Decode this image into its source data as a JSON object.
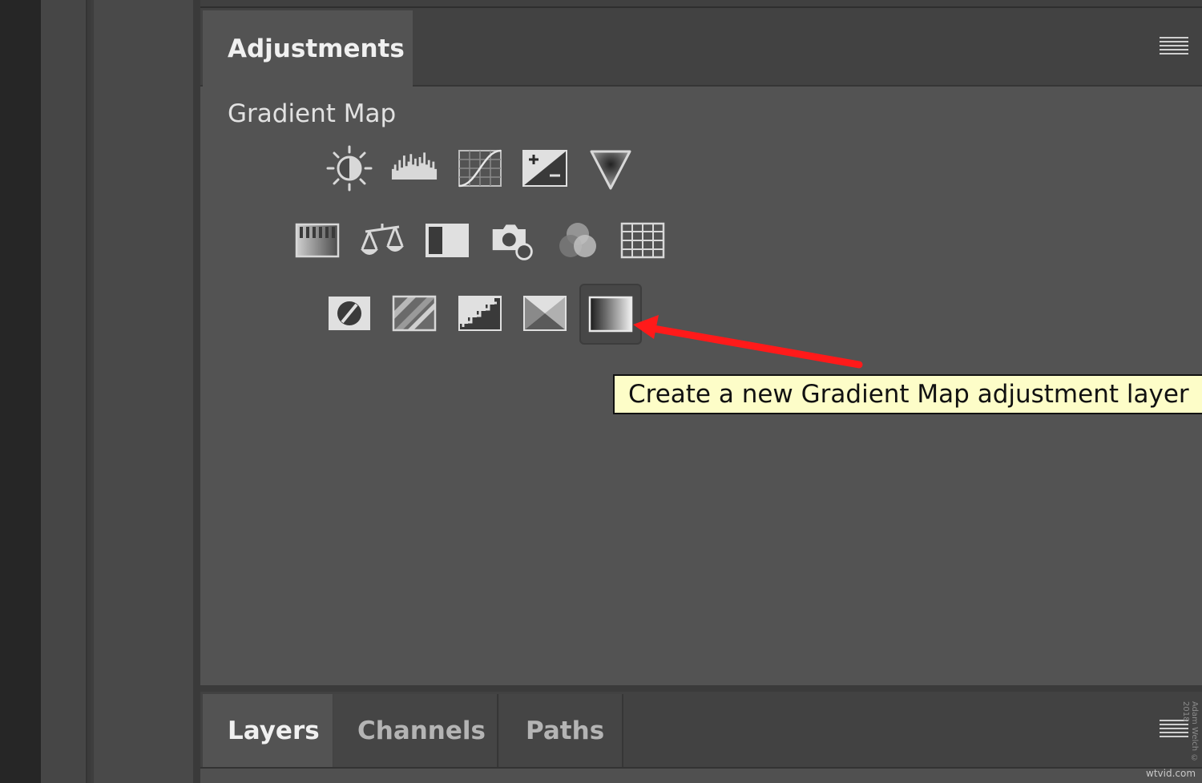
{
  "adjustments_panel": {
    "tab_label": "Adjustments",
    "section_title": "Gradient Map",
    "menu_icon": "panel-menu-icon",
    "icons_row1": [
      "brightness-contrast-icon",
      "levels-icon",
      "curves-icon",
      "exposure-icon",
      "vibrance-icon"
    ],
    "icons_row2": [
      "hue-saturation-icon",
      "color-balance-icon",
      "black-white-icon",
      "photo-filter-icon",
      "channel-mixer-icon",
      "color-lookup-icon"
    ],
    "icons_row3": [
      "invert-icon",
      "posterize-icon",
      "threshold-icon",
      "selective-color-icon",
      "gradient-map-icon"
    ],
    "selected_icon": "gradient-map-icon"
  },
  "tooltip": {
    "text": "Create a new Gradient Map adjustment layer"
  },
  "annotation": {
    "arrow_color": "#ff1a1a"
  },
  "bottom_panel": {
    "tabs": [
      {
        "label": "Layers",
        "active": true
      },
      {
        "label": "Channels",
        "active": false
      },
      {
        "label": "Paths",
        "active": false
      }
    ]
  },
  "watermark": "wtvid.com",
  "credit": "Adam Welch © 2018",
  "colors": {
    "panel_bg": "#535353",
    "tabbar_bg": "#424242",
    "tooltip_bg": "#fdfdc8"
  }
}
